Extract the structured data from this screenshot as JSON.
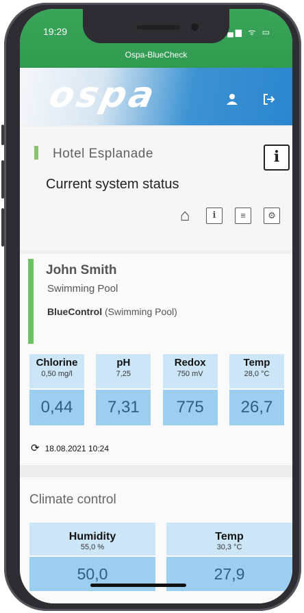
{
  "status_bar": {
    "time": "19:29",
    "signal": "▂▄▆",
    "wifi": "ᯤ",
    "battery": "▭"
  },
  "app": {
    "title": "Ospa-BlueCheck"
  },
  "header": {
    "logo": "ospa",
    "user_icon": "user-icon",
    "logout_icon": "logout-icon"
  },
  "site": {
    "name": "Hotel Esplanade",
    "info_glyph": "i",
    "section_title": "Current system status",
    "nav": {
      "home": "⌂",
      "info": "i",
      "list": "≡",
      "settings": "⚙"
    }
  },
  "device": {
    "owner": "John Smith",
    "pool": "Swimming Pool",
    "controller": "BlueControl",
    "controller_type": "(Swimming Pool)"
  },
  "tiles": [
    {
      "name": "Chlorine",
      "setpoint": "0,50 mg/l",
      "value": "0,44"
    },
    {
      "name": "pH",
      "setpoint": "7,25",
      "value": "7,31"
    },
    {
      "name": "Redox",
      "setpoint": "750 mV",
      "value": "775"
    },
    {
      "name": "Temp",
      "setpoint": "28,0 °C",
      "value": "26,7"
    }
  ],
  "updated": "18.08.2021 10:24",
  "climate": {
    "title": "Climate control",
    "tiles": [
      {
        "name": "Humidity",
        "setpoint": "55,0 %",
        "value": "50,0"
      },
      {
        "name": "Temp",
        "setpoint": "30,3 °C",
        "value": "27,9"
      }
    ]
  },
  "colors": {
    "topbar": "#2f9a50",
    "header_blue": "#2a86cf",
    "tile_light": "#cce6f7",
    "tile_dark": "#9ccfef",
    "accent_green": "#6cc164"
  }
}
